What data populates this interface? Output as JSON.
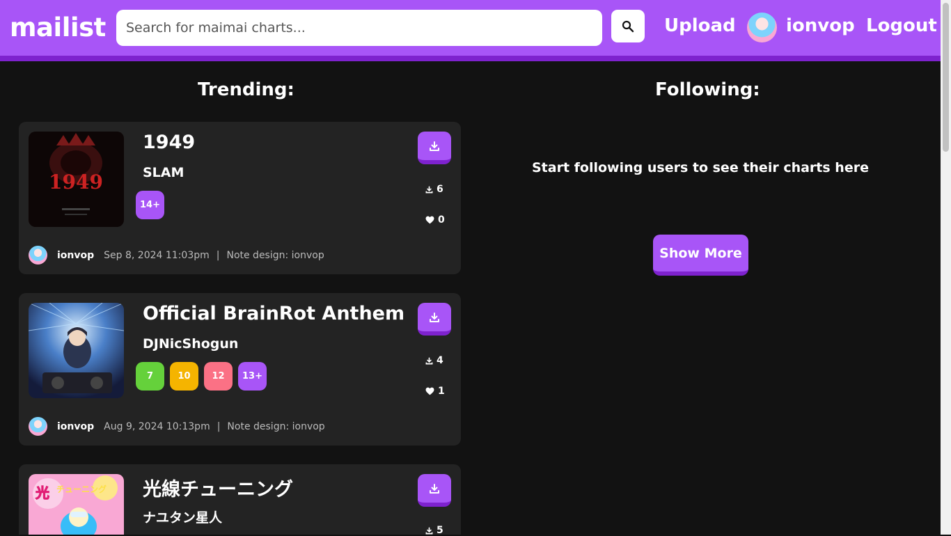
{
  "header": {
    "logo": "mailist",
    "search_placeholder": "Search for maimai charts...",
    "upload_label": "Upload",
    "username": "ionvop",
    "logout_label": "Logout"
  },
  "trending": {
    "title": "Trending:",
    "cards": [
      {
        "title": "1949",
        "artist": "SLAM",
        "levels": [
          {
            "label": "14+",
            "color": "#a855f7"
          }
        ],
        "downloads": "6",
        "likes": "0",
        "user": "ionvop",
        "date": "Sep 8, 2024 11:03pm",
        "separator": "|",
        "note_design": "Note design: ionvop"
      },
      {
        "title": "Official BrainRot Anthem",
        "artist": "DJNicShogun",
        "levels": [
          {
            "label": "7",
            "color": "#65d13b"
          },
          {
            "label": "10",
            "color": "#f5b400"
          },
          {
            "label": "12",
            "color": "#fb7185"
          },
          {
            "label": "13+",
            "color": "#a855f7"
          }
        ],
        "downloads": "4",
        "likes": "1",
        "user": "ionvop",
        "date": "Aug 9, 2024 10:13pm",
        "separator": "|",
        "note_design": "Note design: ionvop"
      },
      {
        "title": "光線チューニング",
        "artist": "ナユタン星人",
        "downloads": "5"
      }
    ]
  },
  "following": {
    "title": "Following:",
    "empty_message": "Start following users to see their charts here",
    "show_more_label": "Show More"
  },
  "colors": {
    "accent": "#a855f7",
    "accent_dark": "#7e22ce",
    "card_bg": "#232323",
    "page_bg": "#121212"
  }
}
